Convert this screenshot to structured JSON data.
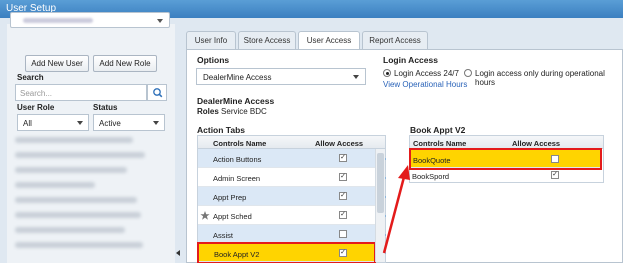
{
  "window": {
    "title": "User Setup"
  },
  "left": {
    "add_user_label": "Add New User",
    "add_role_label": "Add New Role",
    "search_label": "Search",
    "search_placeholder": "Search...",
    "user_role_label": "User Role",
    "status_label": "Status",
    "user_role_value": "All",
    "status_value": "Active"
  },
  "tabs": [
    {
      "label": "User Info"
    },
    {
      "label": "Store Access"
    },
    {
      "label": "User Access"
    },
    {
      "label": "Report Access"
    }
  ],
  "options": {
    "heading": "Options",
    "selected": "DealerMine Access"
  },
  "login_access": {
    "heading": "Login Access",
    "option1": "Login Access 24/7",
    "option2": "Login access only during operational hours",
    "link": "View Operational Hours"
  },
  "dealermine": {
    "heading": "DealerMine Access",
    "roles_label": "Roles",
    "roles_value": "Service BDC"
  },
  "action_tabs": {
    "heading": "Action Tabs",
    "col_name": "Controls Name",
    "col_allow": "Allow Access",
    "rows": [
      {
        "name": "Action Buttons",
        "checked": true
      },
      {
        "name": "Admin Screen",
        "checked": true
      },
      {
        "name": "Appt Prep",
        "checked": true
      },
      {
        "name": "Appt Sched",
        "checked": true
      },
      {
        "name": "Assist",
        "checked": false
      },
      {
        "name": "Book Appt V2",
        "checked": true
      }
    ]
  },
  "book_appt": {
    "heading": "Book Appt V2",
    "col_name": "Controls Name",
    "col_allow": "Allow Access",
    "rows": [
      {
        "name": "BookQuote",
        "checked": false
      },
      {
        "name": "BookSpord",
        "checked": true
      }
    ]
  },
  "colors": {
    "highlight": "#ffd400",
    "annotation": "#e31b1b",
    "titlebar": "#3b7fc0"
  }
}
